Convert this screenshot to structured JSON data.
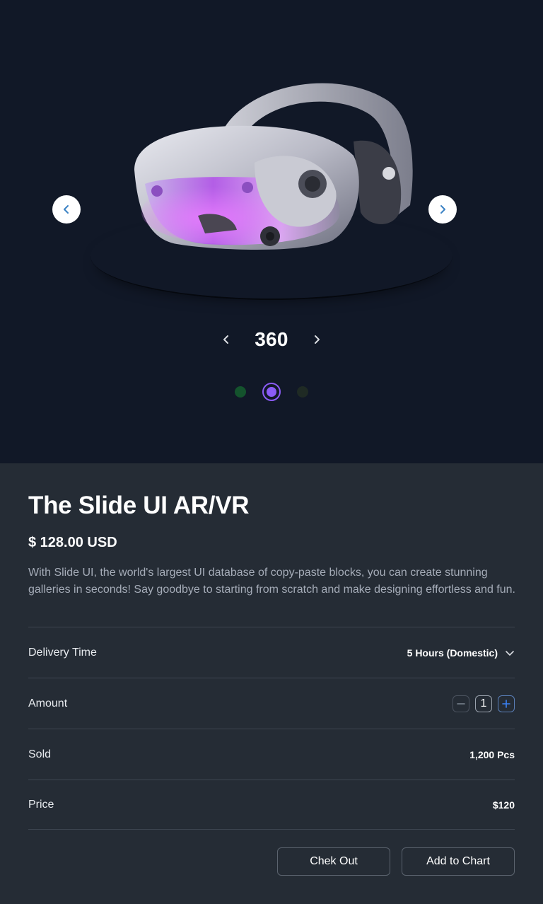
{
  "gallery": {
    "image_alt": "VR headset",
    "view_label": "360",
    "slide_count": 3,
    "active_slide": 2,
    "dot_colors": [
      "#14532d",
      "#8b5cf6",
      "#1f2a24"
    ],
    "accent_color": "#8b5cf6"
  },
  "product": {
    "title": "The Slide UI AR/VR",
    "price": "$ 128.00 USD",
    "description": "With Slide UI, the world's largest UI database of copy-paste blocks, you can create stunning galleries in seconds! Say goodbye to starting from scratch and make designing effortless and fun."
  },
  "rows": {
    "delivery": {
      "label": "Delivery Time",
      "value": "5 Hours (Domestic)"
    },
    "amount": {
      "label": "Amount",
      "value": "1"
    },
    "sold": {
      "label": "Sold",
      "value": "1,200 Pcs"
    },
    "price": {
      "label": "Price",
      "value": "$120"
    }
  },
  "actions": {
    "checkout_label": "Chek Out",
    "add_to_cart_label": "Add to Chart"
  },
  "icons": {
    "prev": "chevron-left-icon",
    "next": "chevron-right-icon",
    "dropdown": "chevron-down-icon",
    "decrement": "minus-icon",
    "increment": "plus-icon"
  }
}
